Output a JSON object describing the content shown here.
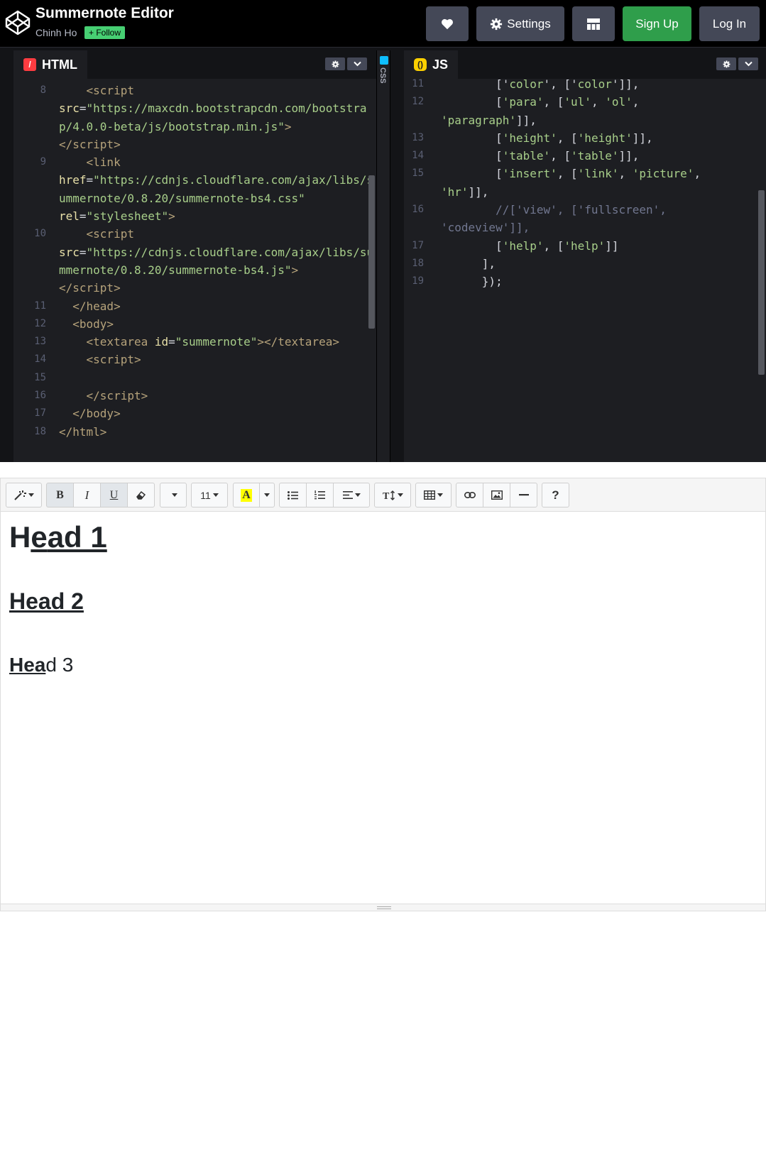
{
  "header": {
    "title": "Summernote Editor",
    "author": "Chinh Ho",
    "follow_label": "+ Follow",
    "heart_icon": "heart-icon",
    "settings_label": "Settings",
    "layout_icon": "layout-grid-icon",
    "signup_label": "Sign Up",
    "login_label": "Log In"
  },
  "html_pane": {
    "tab_label": "HTML"
  },
  "css_pane": {
    "tab_label": "CSS"
  },
  "js_pane": {
    "tab_label": "JS"
  },
  "editor": {
    "toolbar": {
      "font_size": "11",
      "help": "?"
    },
    "content": {
      "heading1_main": "He",
      "heading1_underlined": "e",
      "heading1_sub": "ad 1",
      "heading2": "Head 2",
      "heading3_underlined": "Hea",
      "heading3_rest": "d 3"
    }
  },
  "colors": {
    "header_bg": "#000000",
    "editor_bg": "#1d1e22",
    "follow_green": "#47cf73",
    "signup_green": "#2f9e4b",
    "button_gray": "#444857",
    "html_icon": "#ff3c41",
    "css_icon": "#0ebeff",
    "js_icon": "#fcd000"
  }
}
